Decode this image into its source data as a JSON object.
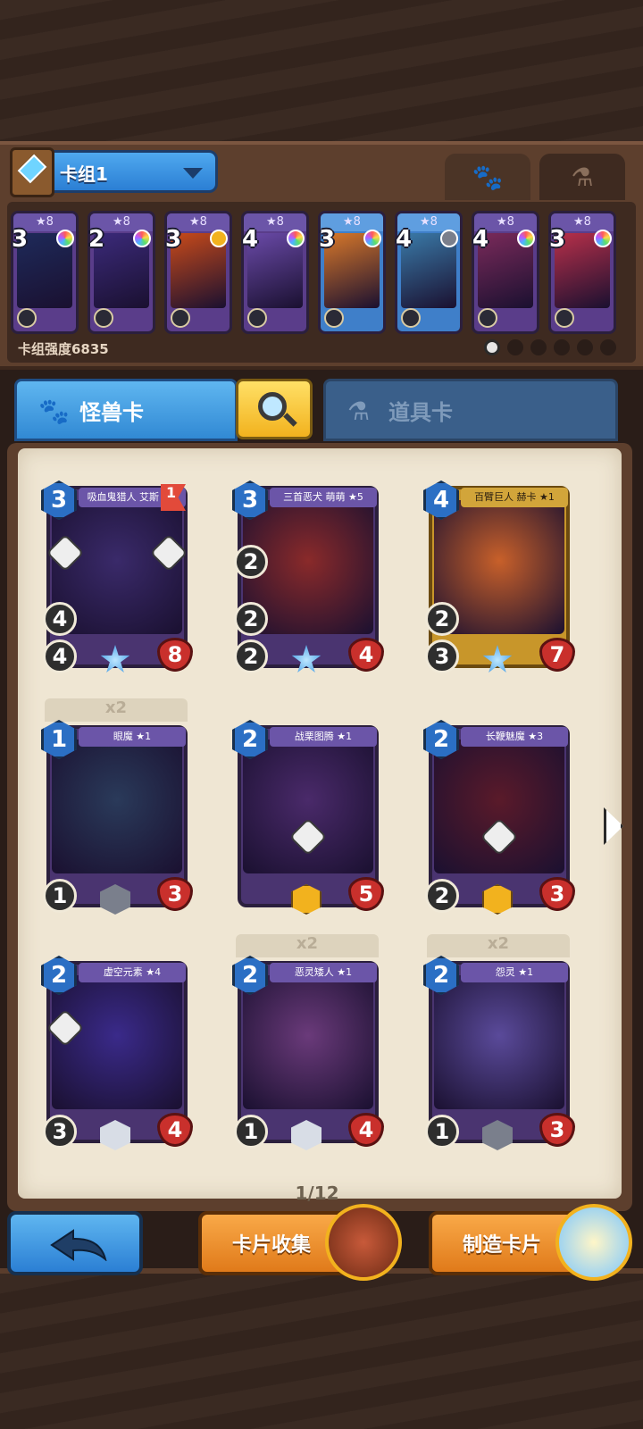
{
  "deck": {
    "name": "卡组1",
    "power_label": "卡组强度6835",
    "tabs": [
      "monster-tab",
      "item-tab"
    ]
  },
  "deck_cards": [
    {
      "stars": "★8",
      "cost": "3",
      "gem": "rainbow",
      "color": "#1e2a5a"
    },
    {
      "stars": "★8",
      "cost": "2",
      "gem": "rainbow",
      "color": "#3b2a7a"
    },
    {
      "stars": "★8",
      "cost": "3",
      "gem": "gold",
      "color": "#c84a1a"
    },
    {
      "stars": "★8",
      "cost": "4",
      "gem": "rainbow",
      "color": "#6a4aa8"
    },
    {
      "stars": "★8",
      "cost": "3",
      "gem": "rainbow",
      "color": "#d8782a"
    },
    {
      "stars": "★8",
      "cost": "4",
      "gem": "grey",
      "color": "#3a7aa8"
    },
    {
      "stars": "★8",
      "cost": "4",
      "gem": "rainbow",
      "color": "#7a2a5a"
    },
    {
      "stars": "★8",
      "cost": "3",
      "gem": "rainbow",
      "color": "#b8304a"
    }
  ],
  "categories": {
    "monster": "怪兽卡",
    "item": "道具卡"
  },
  "cards": [
    {
      "name": "吸血鬼猎人 艾斯 ★8",
      "cost": "3",
      "atk": "4",
      "def": "4",
      "hp": "8",
      "rarity": "star-blue",
      "flag": "1",
      "badge_left": "1",
      "badge_right": "1",
      "art": "#3a2a6a",
      "gold": false
    },
    {
      "name": "三首恶犬 萌萌 ★5",
      "cost": "3",
      "atk": "2",
      "def": "2",
      "extra": "2",
      "hp": "4",
      "rarity": "star-blue",
      "art": "#8a2a2a",
      "gold": false
    },
    {
      "name": "百臂巨人 赫卡 ★1",
      "cost": "4",
      "atk": "2",
      "def": "3",
      "hp": "7",
      "rarity": "star-blue",
      "art": "#c8602a",
      "gold": true
    },
    {
      "name": "眼魔 ★1",
      "cost": "1",
      "def": "1",
      "hp": "3",
      "rarity": "grey",
      "count": "x2",
      "art": "#2a3a5a",
      "gold": false
    },
    {
      "name": "战栗图腾 ★1",
      "cost": "2",
      "hp": "5",
      "rarity": "gold",
      "badge_center": "2",
      "art": "#4a2a6a",
      "gold": false
    },
    {
      "name": "长鞭魅魔 ★3",
      "cost": "2",
      "def": "2",
      "hp": "3",
      "rarity": "gold",
      "badge_center": "2",
      "art": "#5a1a2a",
      "gold": false
    },
    {
      "name": "虚空元素 ★4",
      "cost": "2",
      "def": "3",
      "hp": "4",
      "rarity": "white",
      "badge_left": "1",
      "art": "#3a2a8a",
      "gold": false
    },
    {
      "name": "恶灵矮人 ★1",
      "cost": "2",
      "def": "1",
      "hp": "4",
      "rarity": "white",
      "count": "x2",
      "art": "#6a3a7a",
      "gold": false
    },
    {
      "name": "怨灵 ★1",
      "cost": "2",
      "def": "1",
      "hp": "3",
      "rarity": "grey",
      "count": "x2",
      "art": "#5a4a9a",
      "gold": false
    }
  ],
  "pager": "1/12",
  "buttons": {
    "collect": "卡片收集",
    "craft": "制造卡片"
  },
  "colors": {
    "accent_blue": "#3189d4",
    "accent_orange": "#e07a1a",
    "page": "#efe6d3"
  }
}
